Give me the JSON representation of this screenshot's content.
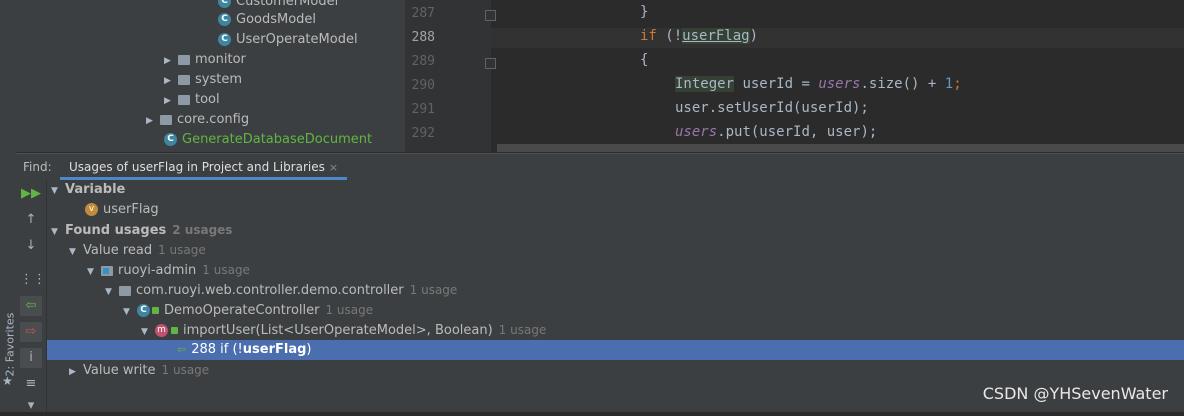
{
  "sidebar": {
    "favorites_label": "2: Favorites"
  },
  "project_tree": {
    "items": [
      {
        "label": "CustomerModel",
        "kind": "class"
      },
      {
        "label": "GoodsModel",
        "kind": "class"
      },
      {
        "label": "UserOperateModel",
        "kind": "class"
      },
      {
        "label": "monitor",
        "kind": "folder"
      },
      {
        "label": "system",
        "kind": "folder"
      },
      {
        "label": "tool",
        "kind": "folder"
      },
      {
        "label": "core.config",
        "kind": "folder"
      },
      {
        "label": "GenerateDatabaseDocument",
        "kind": "class-main"
      }
    ]
  },
  "editor": {
    "line_numbers": [
      "287",
      "288",
      "289",
      "290",
      "291",
      "292"
    ],
    "current_line": "288",
    "lines": {
      "l287_brace": "}",
      "l288_kw": "if",
      "l288_open": " (!",
      "l288_var": "userFlag",
      "l288_close": ")",
      "l289_brace": "{",
      "l290_type": "Integer",
      "l290_mid": " userId = ",
      "l290_field": "users",
      "l290_call": ".size() + ",
      "l290_num": "1",
      "l290_end": ";",
      "l291": "user.setUserId(userId);",
      "l292_field": "users",
      "l292_call": ".put(userId, user);"
    }
  },
  "find_panel": {
    "find_label": "Find:",
    "tab_label": "Usages of userFlag in Project and Libraries",
    "tab_close": "×"
  },
  "results": {
    "variable_header": "Variable",
    "variable_name": "userFlag",
    "found_usages": "Found usages",
    "found_usages_count": "2 usages",
    "value_read": "Value read",
    "value_read_count": "1 usage",
    "module": "ruoyi-admin",
    "module_count": "1 usage",
    "package": "com.ruoyi.web.controller.demo.controller",
    "package_count": "1 usage",
    "class_name": "DemoOperateController",
    "class_count": "1 usage",
    "method": "importUser(List<UserOperateModel>, Boolean)",
    "method_count": "1 usage",
    "usage_line_prefix": "288 if (!",
    "usage_line_var": "userFlag",
    "usage_line_suffix": ")",
    "value_write": "Value write",
    "value_write_count": "1 usage"
  },
  "watermark": "CSDN @YHSevenWater"
}
